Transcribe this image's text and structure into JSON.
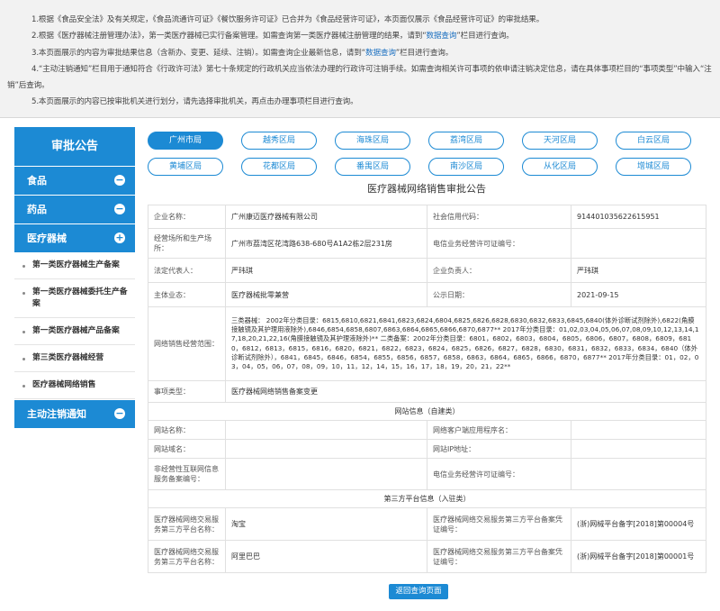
{
  "notice": {
    "p1": "1.根据《食品安全法》及有关规定，《食品流通许可证》《餐饮服务许可证》已合并为《食品经营许可证》，本页面仅展示《食品经营许可证》的审批结果。",
    "p2a": "2.根据《医疗器械注册管理办法》，第一类医疗器械已实行备案管理。如需查询第一类医疗器械注册管理的结果，请到“",
    "p2link": "数据查询",
    "p2b": "”栏目进行查询。",
    "p3a": "3.本页面展示的内容为审批结果信息（含新办、变更、延续、注销）。如需查询企业最新信息，请到“",
    "p3link": "数据查询",
    "p3b": "”栏目进行查询。",
    "p4": "4.“主动注销通知”栏目用于通知符合《行政许可法》第七十条规定的行政机关应当依法办理的行政许可注销手续。如需查询相关许可事项的依申请注销决定信息，请在具体事项栏目的“事项类型”中输入“注销”后查询。",
    "p5": "5.本页面展示的内容已按审批机关进行划分，请先选择审批机关，再点击办理事项栏目进行查询。"
  },
  "sidebar": {
    "title": "审批公告",
    "cats": [
      {
        "label": "食品",
        "toggle": "−"
      },
      {
        "label": "药品",
        "toggle": "−"
      },
      {
        "label": "医疗器械",
        "toggle": "+"
      }
    ],
    "subs": [
      "第一类医疗器械生产备案",
      "第一类医疗器械委托生产备案",
      "第一类医疗器械产品备案",
      "第三类医疗器械经营",
      "医疗器械网络销售"
    ],
    "cat4": {
      "label": "主动注销通知",
      "toggle": "−"
    }
  },
  "areas": [
    "广州市局",
    "越秀区局",
    "海珠区局",
    "荔湾区局",
    "天河区局",
    "白云区局",
    "黄埔区局",
    "花都区局",
    "番禺区局",
    "南沙区局",
    "从化区局",
    "增城区局"
  ],
  "page_title": "医疗器械网络销售审批公告",
  "detail": {
    "company_label": "企业名称：",
    "company": "广州康迈医疗器械有限公司",
    "credit_label": "社会信用代码：",
    "credit": "914401035622615951",
    "address_label": "经营场所和生产场所：",
    "address": "广州市荔湾区花湾路638-680号A1A2栋2层231房",
    "telecom_label": "电信业务经营许可证编号：",
    "telecom": "",
    "legal_label": "法定代表人：",
    "legal": "严玮琪",
    "principal_label": "企业负责人：",
    "principal": "严玮琪",
    "business_label": "主体业态：",
    "business": "医疗器械批零兼营",
    "pubdate_label": "公示日期：",
    "pubdate": "2021-09-15",
    "scope_label": "网络销售经营范围：",
    "scope": "三类器械： 2002年分类目录：6815,6810,6821,6841,6823,6824,6804,6825,6826,6828,6830,6832,6833,6845,6840(体外诊断试剂除外),6822(角膜接触镜及其护理用液除外),6846,6854,6858,6807,6863,6864,6865,6866,6870,6877** 2017年分类目录：01,02,03,04,05,06,07,08,09,10,12,13,14,17,18,20,21,22,16(角膜接触镜及其护理液除外)** 二类备案：2002年分类目录：6801，6802，6803，6804，6805，6806，6807，6808，6809，6810，6812，6813，6815，6816，6820，6821，6822，6823，6824，6825，6826，6827，6828，6830，6831，6832，6833，6834，6840（体外诊断试剂除外），6841，6845，6846，6854，6855，6856，6857，6858，6863，6864，6865，6866，6870，6877** 2017年分类目录：01，02，03，04，05，06，07，08，09，10，11，12，14，15，16，17，18，19，20，21，22**",
    "type_label": "事项类型：",
    "type": "医疗器械网络销售备案变更",
    "web_section": "网站信息（自建类）",
    "site_name_label": "网站名称：",
    "site_name": "",
    "client_label": "网络客户端应用程序名：",
    "client": "",
    "domain_label": "网站域名：",
    "domain": "",
    "ip_label": "网站IP地址：",
    "ip": "",
    "icp_label": "非经营性互联网信息服务备案编号：",
    "icp": "",
    "telecom2_label": "电信业务经营许可证编号：",
    "telecom2": "",
    "third_section": "第三方平台信息（入驻类）",
    "p1_name_label": "医疗器械网络交易服务第三方平台名称：",
    "p1_name": "淘宝",
    "p1_cert_label": "医疗器械网络交易服务第三方平台备案凭证编号：",
    "p1_cert": "(浙)网械平台备字[2018]第00004号",
    "p2_name_label": "医疗器械网络交易服务第三方平台名称：",
    "p2_name": "阿里巴巴",
    "p2_cert_label": "医疗器械网络交易服务第三方平台备案凭证编号：",
    "p2_cert": "(浙)网械平台备字[2018]第00001号"
  },
  "back_label": "返回查询页面",
  "colors": {
    "accent": "#1c8ad4",
    "notice_bg": "#f2f2f2"
  }
}
